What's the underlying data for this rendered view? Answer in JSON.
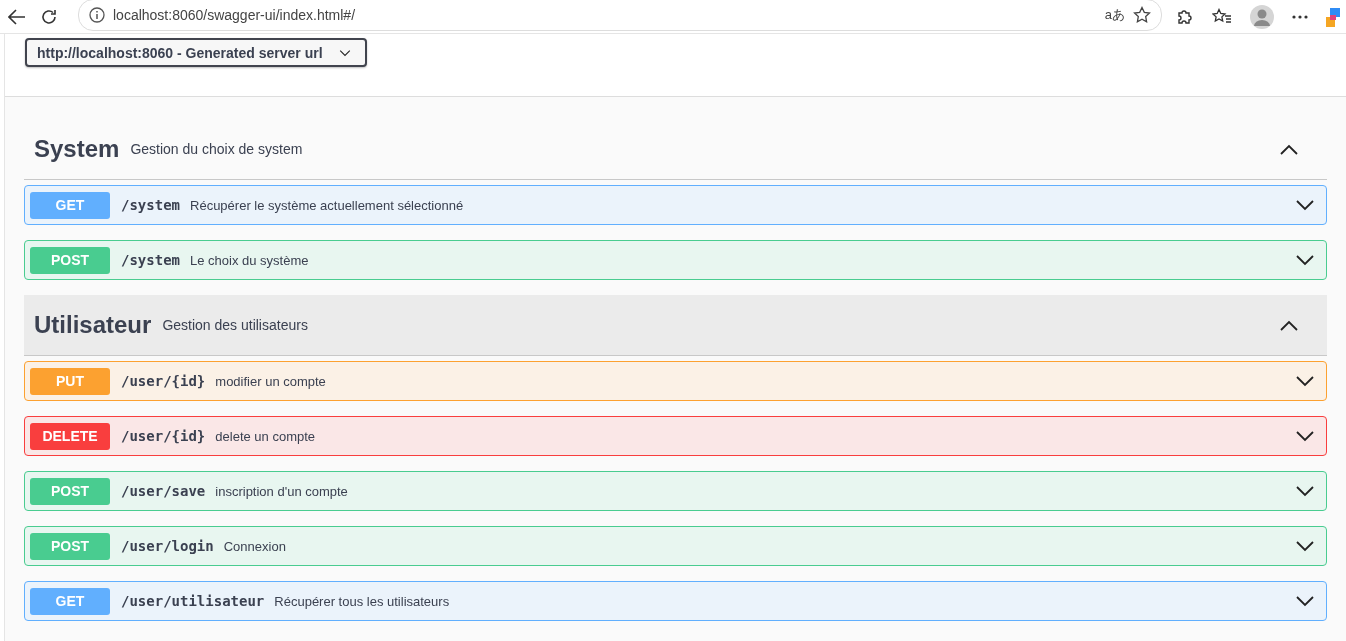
{
  "browser": {
    "url": "localhost:8060/swagger-ui/index.html#/",
    "translate_label": "aあ"
  },
  "server_select": {
    "value": "http://localhost:8060 - Generated server url"
  },
  "tags": [
    {
      "name": "System",
      "description": "Gestion du choix de system",
      "expanded": true,
      "highlighted": false,
      "operations": [
        {
          "method": "GET",
          "path": "/system",
          "summary": "Récupérer le système actuellement sélectionné",
          "expanded": false
        },
        {
          "method": "POST",
          "path": "/system",
          "summary": "Le choix du système",
          "expanded": false
        }
      ]
    },
    {
      "name": "Utilisateur",
      "description": "Gestion des utilisateurs",
      "expanded": true,
      "highlighted": true,
      "operations": [
        {
          "method": "PUT",
          "path": "/user/{id}",
          "summary": "modifier un compte",
          "expanded": false
        },
        {
          "method": "DELETE",
          "path": "/user/{id}",
          "summary": "delete un compte",
          "expanded": false
        },
        {
          "method": "POST",
          "path": "/user/save",
          "summary": "inscription d'un compte",
          "expanded": false
        },
        {
          "method": "POST",
          "path": "/user/login",
          "summary": "Connexion",
          "expanded": false
        },
        {
          "method": "GET",
          "path": "/user/utilisateur",
          "summary": "Récupérer tous les utilisateurs",
          "expanded": false
        }
      ]
    }
  ]
}
